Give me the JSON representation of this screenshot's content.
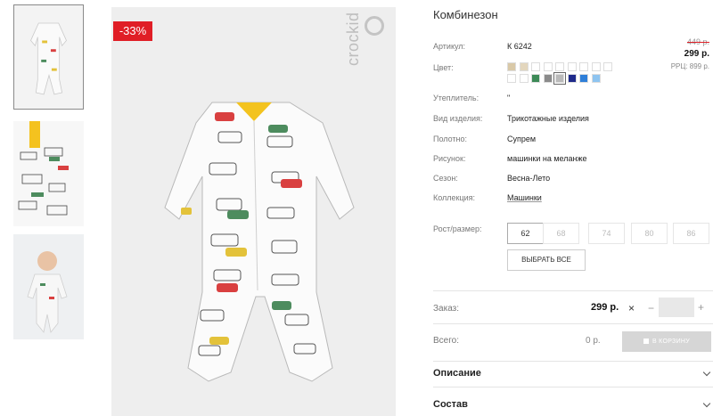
{
  "discount": "-33%",
  "brand": "crockid",
  "product": {
    "title": "Комбинезон",
    "specs": [
      {
        "label": "Артикул:",
        "value": "К 6242"
      },
      {
        "label": "Цвет:",
        "value": ""
      },
      {
        "label": "Утеплитель:",
        "value": "\""
      },
      {
        "label": "Вид изделия:",
        "value": "Трикотажные изделия"
      },
      {
        "label": "Полотно:",
        "value": "Супрем"
      },
      {
        "label": "Рисунок:",
        "value": "машинки на меланже"
      },
      {
        "label": "Сезон:",
        "value": "Весна-Лето"
      },
      {
        "label": "Коллекция:",
        "value": "Машинки"
      }
    ],
    "old_price": "449 р.",
    "price": "299 р.",
    "rrc": "РРЦ: 899 р.",
    "colors": {
      "row1": [
        "#d9c9a8",
        "#e3d6bd",
        "#ffffff",
        "#ffffff",
        "#ffffff",
        "#ffffff",
        "#ffffff",
        "#ffffff",
        "#ffffff"
      ],
      "row2": [
        "#ffffff",
        "#ffffff",
        "#3d8a57",
        "#8b8b8b",
        "#b9b9b9",
        "#1f2a8a",
        "#2f7fd8",
        "#8ec4f0"
      ]
    },
    "size_label": "Рост/размер:",
    "sizes": [
      "62",
      "68",
      "74",
      "80",
      "86"
    ],
    "select_all": "ВЫБРАТЬ ВСЕ",
    "order_label": "Заказ:",
    "order_price": "299 р.",
    "total_label": "Всего:",
    "total_value": "0 р.",
    "cart_button": "В КОРЗИНУ",
    "sections": [
      "Описание",
      "Состав"
    ]
  },
  "accent": "#e01e26"
}
